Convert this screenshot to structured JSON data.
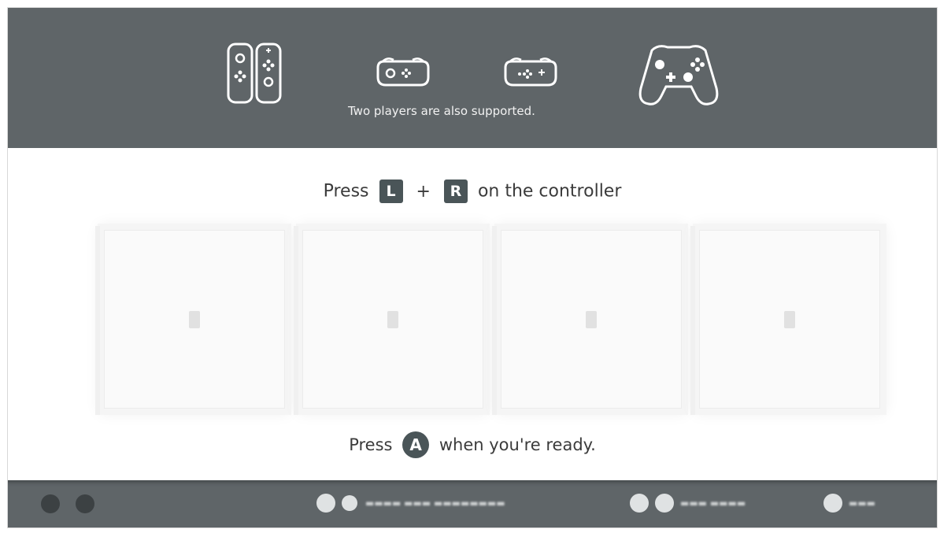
{
  "banner": {
    "caption": "Two players are also supported.",
    "icons": [
      "joycon-pair-icon",
      "joycon-sideways-left-icon",
      "joycon-sideways-right-icon",
      "pro-controller-icon"
    ]
  },
  "instruction": {
    "prefix": "Press",
    "key_left": "L",
    "plus": "+",
    "key_right": "R",
    "suffix": "on the controller"
  },
  "slots": [
    {
      "name": "player-slot-1"
    },
    {
      "name": "player-slot-2"
    },
    {
      "name": "player-slot-3"
    },
    {
      "name": "player-slot-4"
    }
  ],
  "ready": {
    "prefix": "Press",
    "button": "A",
    "suffix": "when you're ready."
  },
  "bottom_bar": {
    "hints": [
      {
        "text": "▬▬▬▬ ▬▬▬ ▬▬▬▬▬▬▬▬"
      },
      {
        "text": "▬▬▬ ▬▬▬▬"
      },
      {
        "text": "▬▬▬"
      }
    ]
  }
}
